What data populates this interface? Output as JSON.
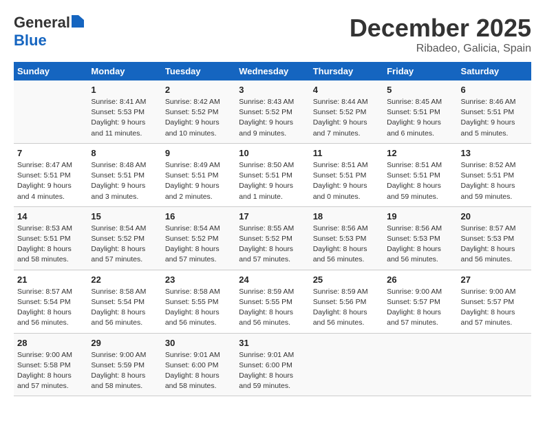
{
  "header": {
    "logo_line1": "General",
    "logo_line2": "Blue",
    "month": "December 2025",
    "location": "Ribadeo, Galicia, Spain"
  },
  "days_of_week": [
    "Sunday",
    "Monday",
    "Tuesday",
    "Wednesday",
    "Thursday",
    "Friday",
    "Saturday"
  ],
  "weeks": [
    [
      {
        "day": "",
        "info": ""
      },
      {
        "day": "1",
        "info": "Sunrise: 8:41 AM\nSunset: 5:53 PM\nDaylight: 9 hours\nand 11 minutes."
      },
      {
        "day": "2",
        "info": "Sunrise: 8:42 AM\nSunset: 5:52 PM\nDaylight: 9 hours\nand 10 minutes."
      },
      {
        "day": "3",
        "info": "Sunrise: 8:43 AM\nSunset: 5:52 PM\nDaylight: 9 hours\nand 9 minutes."
      },
      {
        "day": "4",
        "info": "Sunrise: 8:44 AM\nSunset: 5:52 PM\nDaylight: 9 hours\nand 7 minutes."
      },
      {
        "day": "5",
        "info": "Sunrise: 8:45 AM\nSunset: 5:51 PM\nDaylight: 9 hours\nand 6 minutes."
      },
      {
        "day": "6",
        "info": "Sunrise: 8:46 AM\nSunset: 5:51 PM\nDaylight: 9 hours\nand 5 minutes."
      }
    ],
    [
      {
        "day": "7",
        "info": "Sunrise: 8:47 AM\nSunset: 5:51 PM\nDaylight: 9 hours\nand 4 minutes."
      },
      {
        "day": "8",
        "info": "Sunrise: 8:48 AM\nSunset: 5:51 PM\nDaylight: 9 hours\nand 3 minutes."
      },
      {
        "day": "9",
        "info": "Sunrise: 8:49 AM\nSunset: 5:51 PM\nDaylight: 9 hours\nand 2 minutes."
      },
      {
        "day": "10",
        "info": "Sunrise: 8:50 AM\nSunset: 5:51 PM\nDaylight: 9 hours\nand 1 minute."
      },
      {
        "day": "11",
        "info": "Sunrise: 8:51 AM\nSunset: 5:51 PM\nDaylight: 9 hours\nand 0 minutes."
      },
      {
        "day": "12",
        "info": "Sunrise: 8:51 AM\nSunset: 5:51 PM\nDaylight: 8 hours\nand 59 minutes."
      },
      {
        "day": "13",
        "info": "Sunrise: 8:52 AM\nSunset: 5:51 PM\nDaylight: 8 hours\nand 59 minutes."
      }
    ],
    [
      {
        "day": "14",
        "info": "Sunrise: 8:53 AM\nSunset: 5:51 PM\nDaylight: 8 hours\nand 58 minutes."
      },
      {
        "day": "15",
        "info": "Sunrise: 8:54 AM\nSunset: 5:52 PM\nDaylight: 8 hours\nand 57 minutes."
      },
      {
        "day": "16",
        "info": "Sunrise: 8:54 AM\nSunset: 5:52 PM\nDaylight: 8 hours\nand 57 minutes."
      },
      {
        "day": "17",
        "info": "Sunrise: 8:55 AM\nSunset: 5:52 PM\nDaylight: 8 hours\nand 57 minutes."
      },
      {
        "day": "18",
        "info": "Sunrise: 8:56 AM\nSunset: 5:53 PM\nDaylight: 8 hours\nand 56 minutes."
      },
      {
        "day": "19",
        "info": "Sunrise: 8:56 AM\nSunset: 5:53 PM\nDaylight: 8 hours\nand 56 minutes."
      },
      {
        "day": "20",
        "info": "Sunrise: 8:57 AM\nSunset: 5:53 PM\nDaylight: 8 hours\nand 56 minutes."
      }
    ],
    [
      {
        "day": "21",
        "info": "Sunrise: 8:57 AM\nSunset: 5:54 PM\nDaylight: 8 hours\nand 56 minutes."
      },
      {
        "day": "22",
        "info": "Sunrise: 8:58 AM\nSunset: 5:54 PM\nDaylight: 8 hours\nand 56 minutes."
      },
      {
        "day": "23",
        "info": "Sunrise: 8:58 AM\nSunset: 5:55 PM\nDaylight: 8 hours\nand 56 minutes."
      },
      {
        "day": "24",
        "info": "Sunrise: 8:59 AM\nSunset: 5:55 PM\nDaylight: 8 hours\nand 56 minutes."
      },
      {
        "day": "25",
        "info": "Sunrise: 8:59 AM\nSunset: 5:56 PM\nDaylight: 8 hours\nand 56 minutes."
      },
      {
        "day": "26",
        "info": "Sunrise: 9:00 AM\nSunset: 5:57 PM\nDaylight: 8 hours\nand 57 minutes."
      },
      {
        "day": "27",
        "info": "Sunrise: 9:00 AM\nSunset: 5:57 PM\nDaylight: 8 hours\nand 57 minutes."
      }
    ],
    [
      {
        "day": "28",
        "info": "Sunrise: 9:00 AM\nSunset: 5:58 PM\nDaylight: 8 hours\nand 57 minutes."
      },
      {
        "day": "29",
        "info": "Sunrise: 9:00 AM\nSunset: 5:59 PM\nDaylight: 8 hours\nand 58 minutes."
      },
      {
        "day": "30",
        "info": "Sunrise: 9:01 AM\nSunset: 6:00 PM\nDaylight: 8 hours\nand 58 minutes."
      },
      {
        "day": "31",
        "info": "Sunrise: 9:01 AM\nSunset: 6:00 PM\nDaylight: 8 hours\nand 59 minutes."
      },
      {
        "day": "",
        "info": ""
      },
      {
        "day": "",
        "info": ""
      },
      {
        "day": "",
        "info": ""
      }
    ]
  ]
}
